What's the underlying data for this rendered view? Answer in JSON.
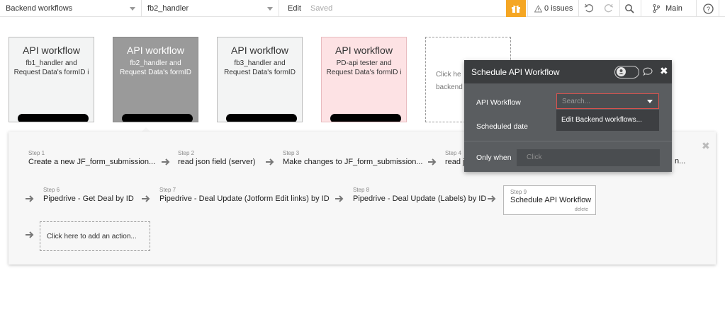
{
  "topbar": {
    "page_select": "Backend workflows",
    "workflow_select": "fb2_handler",
    "edit_label": "Edit",
    "saved_label": "Saved",
    "issues_label": "0 issues",
    "branch_label": "Main",
    "icons": [
      "gift-icon",
      "warning-icon",
      "undo-icon",
      "redo-icon",
      "search-icon",
      "branch-icon",
      "help-icon"
    ]
  },
  "cards": [
    {
      "title": "API workflow",
      "desc": "fb1_handler and Request Data's formID i",
      "style": "gray"
    },
    {
      "title": "API workflow",
      "desc": "fb2_handler and Request Data's formID",
      "style": "selected"
    },
    {
      "title": "API workflow",
      "desc": "fb3_handler and Request Data's formID",
      "style": "gray"
    },
    {
      "title": "API workflow",
      "desc": "PD-api tester and Request Data's formID i",
      "style": "pink"
    }
  ],
  "add_workflow_card": {
    "line1": "Click he",
    "line2": "backend"
  },
  "steps_row1": [
    {
      "num": "Step 1",
      "name": "Create a new JF_form_submission..."
    },
    {
      "num": "Step 2",
      "name": "read json field (server)"
    },
    {
      "num": "Step 3",
      "name": "Make changes to JF_form_submission..."
    },
    {
      "num": "Step 4",
      "name": "read j"
    }
  ],
  "step_row1_overflow": "n...",
  "steps_row2": [
    {
      "num": "Step 6",
      "name": "Pipedrive - Get Deal by ID"
    },
    {
      "num": "Step 7",
      "name": "Pipedrive - Deal Update (Jotform Edit links) by ID"
    },
    {
      "num": "Step 8",
      "name": "Pipedrive - Deal Update (Labels) by ID"
    }
  ],
  "step9": {
    "num": "Step 9",
    "name": "Schedule API Workflow",
    "delete": "delete"
  },
  "add_action": "Click here to add an action...",
  "popup": {
    "title": "Schedule API Workflow",
    "api_workflow_label": "API Workflow",
    "search_placeholder": "Search...",
    "dropdown_option": "Edit Backend workflows...",
    "scheduled_date_label": "Scheduled date",
    "only_when_label": "Only when",
    "click_placeholder": "Click"
  },
  "colors": {
    "gift": "#f5a623",
    "selected_card": "#9a9a9a",
    "pink_card": "#fde2e4",
    "popup_bg": "#5a5d60",
    "popup_header": "#3b3d3f",
    "search_border": "#d9534f"
  }
}
